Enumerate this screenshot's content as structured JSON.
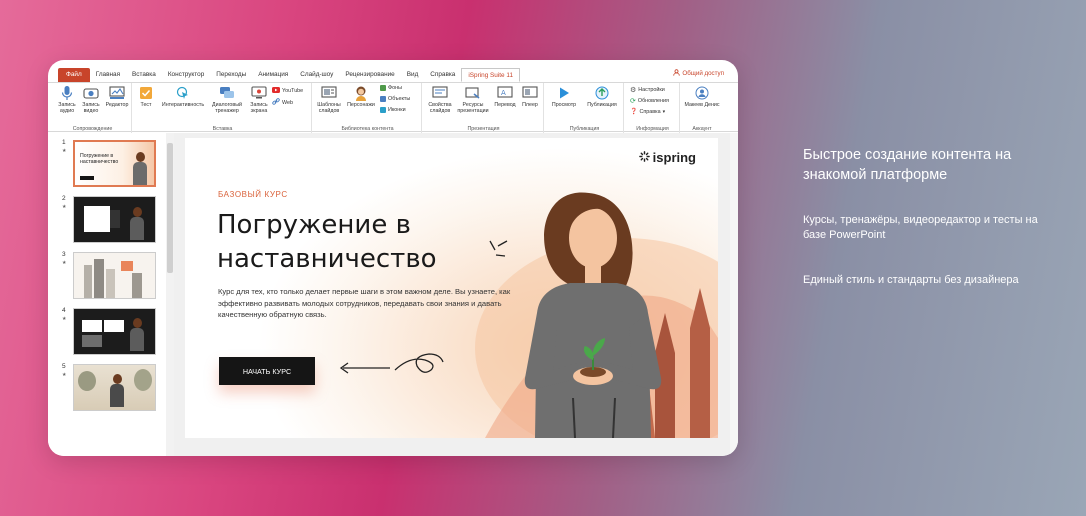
{
  "ribbon": {
    "tabs": [
      "Файл",
      "Главная",
      "Вставка",
      "Конструктор",
      "Переходы",
      "Анимация",
      "Слайд-шоу",
      "Рецензирование",
      "Вид",
      "Справка",
      "iSpring Suite 11"
    ],
    "share": "Общий доступ",
    "groups": {
      "record": {
        "label": "Сопровождение",
        "buttons": [
          "Запись аудио",
          "Запись видео",
          "Редактор"
        ]
      },
      "insert": {
        "label": "Вставка",
        "buttons": [
          "Тест",
          "Интерактивность",
          "Диалоговый тренажер",
          "Запись экрана"
        ],
        "small": [
          "YouTube",
          "Web"
        ]
      },
      "library": {
        "label": "Библиотека контента",
        "buttons": [
          "Шаблоны слайдов",
          "Персонажи"
        ],
        "small": [
          "Фоны",
          "Объекты",
          "Иконки"
        ]
      },
      "presentation": {
        "label": "Презентация",
        "buttons": [
          "Свойства слайдов",
          "Ресурсы презентации",
          "Перевод",
          "Плеер"
        ]
      },
      "publish": {
        "label": "Публикация",
        "buttons": [
          "Просмотр",
          "Публикация"
        ]
      },
      "info": {
        "label": "Информация",
        "small": [
          "Настройки",
          "Обновления",
          "Справка"
        ]
      },
      "account": {
        "label": "Аккаунт",
        "user": "Макеев Денис"
      }
    }
  },
  "thumbnails": [
    {
      "num": "1",
      "title": "Погружение в наставничество"
    },
    {
      "num": "2"
    },
    {
      "num": "3"
    },
    {
      "num": "4"
    },
    {
      "num": "5"
    }
  ],
  "slide": {
    "logo": "ispring",
    "kicker": "БАЗОВЫЙ КУРС",
    "title": "Погружение в наставничество",
    "description": "Курс для тех, кто только делает первые шаги в этом важном деле. Вы узнаете, как эффективно развивать молодых сотрудников, передавать свои знания и давать качественную обратную связь.",
    "cta": "НАЧАТЬ КУРС"
  },
  "side": {
    "title": "Быстрое создание контента на знакомой платформе",
    "p1": "Курсы, тренажёры, видеоредактор и тесты на базе PowerPoint",
    "p2": "Единый стиль и стандарты без дизайнера"
  },
  "colors": {
    "accent": "#c8442a",
    "slide_kicker": "#d9623b",
    "cta_bg": "#151515"
  }
}
